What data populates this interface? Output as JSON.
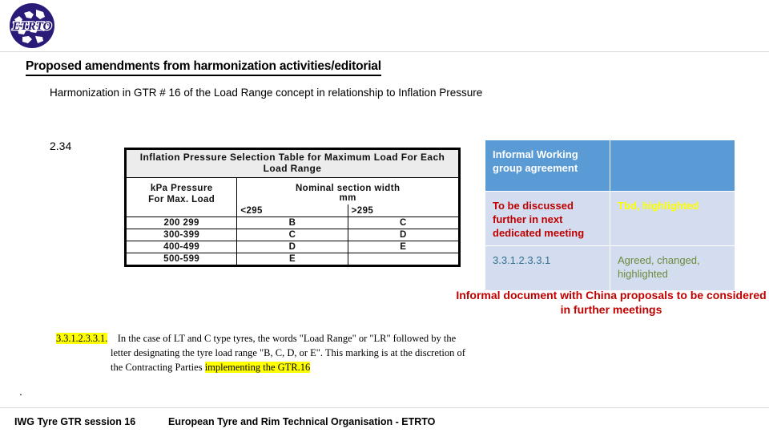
{
  "header": {
    "logo_name": "etrto-logo",
    "logo_text": "ETRTO",
    "logo_color": "#2B1B78"
  },
  "title": {
    "main": "Proposed amendments from  harmonization activities/editorial",
    "subtitle": "Harmonization in GTR # 16 of the Load Range concept  in relationship to Inflation Pressure"
  },
  "slide_number": "2.34",
  "pressure_table": {
    "title": "Inflation Pressure Selection Table for Maximum Load For Each Load Range",
    "col1_header": "kPa Pressure For Max. Load",
    "col1_header_line1": "kPa Pressure",
    "col1_header_line2": "For Max. Load",
    "col2_header_line1": "Nominal section width",
    "col2_header_line2": "mm",
    "sub_headers": [
      "<295",
      ">295"
    ],
    "rows": [
      {
        "pressure": "200 299",
        "lt295": "B",
        "gt295": "C"
      },
      {
        "pressure": "300-399",
        "lt295": "C",
        "gt295": "D"
      },
      {
        "pressure": "400-499",
        "lt295": "D",
        "gt295": "E"
      },
      {
        "pressure": "500-599",
        "lt295": "E",
        "gt295": ""
      }
    ]
  },
  "agreement_table": {
    "header_left": "Informal Working group agreement",
    "header_right": "",
    "row2_left": "To be discussed further in next dedicated meeting",
    "row2_right": "Tbd, highlighted",
    "row3_left": "3.3.1.2.3.3.1",
    "row3_right": "Agreed, changed, highlighted",
    "colors": {
      "header_bg": "#5B9BD5",
      "body_bg": "#D3DDEF",
      "red_text": "#C00000",
      "yellow_text": "#FFFF00",
      "green_text": "#6C8B3C",
      "number_text": "#31708E"
    }
  },
  "china_note": "Informal document with China proposals to be considered in further meetings",
  "regulation": {
    "clause_number": "3.3.1.2.3.3.1.",
    "line1": "In the case of LT and C type tyres, the words \"Load Range\" or \"LR\" followed by the",
    "line2": "letter designating the tyre load range \"B, C, D, or E\".  This  marking is at the discretion of",
    "line3_prefix": "the Contracting Parties ",
    "line3_highlight": "implementing the GTR.16",
    "highlight_color": "#FFFF00"
  },
  "stray_dot": ".",
  "footer": {
    "left": "IWG Tyre GTR session 16",
    "center": "European Tyre and Rim Technical Organisation - ETRTO"
  }
}
